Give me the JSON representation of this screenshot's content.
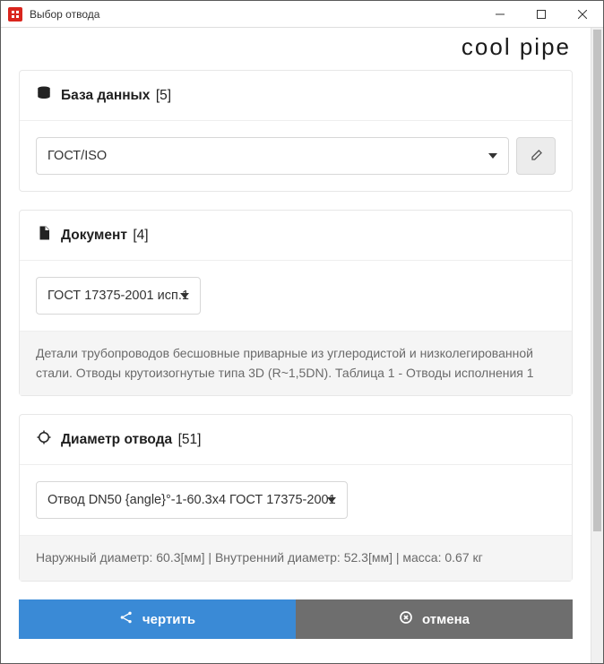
{
  "window": {
    "title": "Выбор отвода"
  },
  "brand": "cooL pipe",
  "database": {
    "title": "База данных",
    "count": "[5]",
    "selected": "ГОСТ/ISO"
  },
  "document": {
    "title": "Документ",
    "count": "[4]",
    "selected": "ГОСТ 17375-2001 исп.1",
    "description": "Детали трубопроводов бесшовные приварные из углеродистой и низколегированной стали. Отводы крутоизогнутые типа 3D (R~1,5DN). Таблица 1 - Отводы исполнения 1"
  },
  "diameter": {
    "title": "Диаметр отвода",
    "count": "[51]",
    "selected": "Отвод DN50 {angle}°-1-60.3x4 ГОСТ 17375-2001",
    "description": "Наружный диаметр: 60.3[мм] | Внутренний диаметр: 52.3[мм] | масса: 0.67 кг"
  },
  "actions": {
    "draw": "чертить",
    "cancel": "отмена"
  }
}
